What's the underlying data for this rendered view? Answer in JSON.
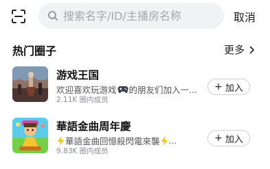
{
  "header": {
    "scan_icon": "scan-icon",
    "search_icon": "search-icon",
    "search_placeholder": "搜索名字/ID/主播房名称",
    "search_value": "",
    "cancel_label": "取消"
  },
  "section": {
    "title": "热门圈子",
    "more_label": "更多",
    "more_icon": "chevron-right-icon"
  },
  "groups": [
    {
      "name": "游戏王国",
      "description_before_icon": "欢迎喜欢玩游戏",
      "description_icon": "gamepad-icon",
      "description_after_icon": "的朋友们加入一...",
      "member_count": "2.11K",
      "member_label": "圈内成员",
      "join_plus": "+",
      "join_label": "加入"
    },
    {
      "name": "華語金曲周年慶",
      "description_before_icon": "",
      "description_icon": "lightning-icon",
      "description_after_icon": "華語金曲回憶殺閃電來襲",
      "description_trailing_icon": "lightning-icon",
      "description_ellipsis": "...",
      "member_count": "9.83K",
      "member_label": "圈内成员",
      "join_plus": "+",
      "join_label": "加入"
    }
  ],
  "colors": {
    "background": "#ffffff",
    "search_bg": "#f1f2f5",
    "placeholder": "#a3a6ad",
    "primary_text": "#111111",
    "secondary_text": "#555555",
    "meta_text": "#8a8d93",
    "button_border": "#cfd1d6",
    "lightning": "#f5c518"
  }
}
